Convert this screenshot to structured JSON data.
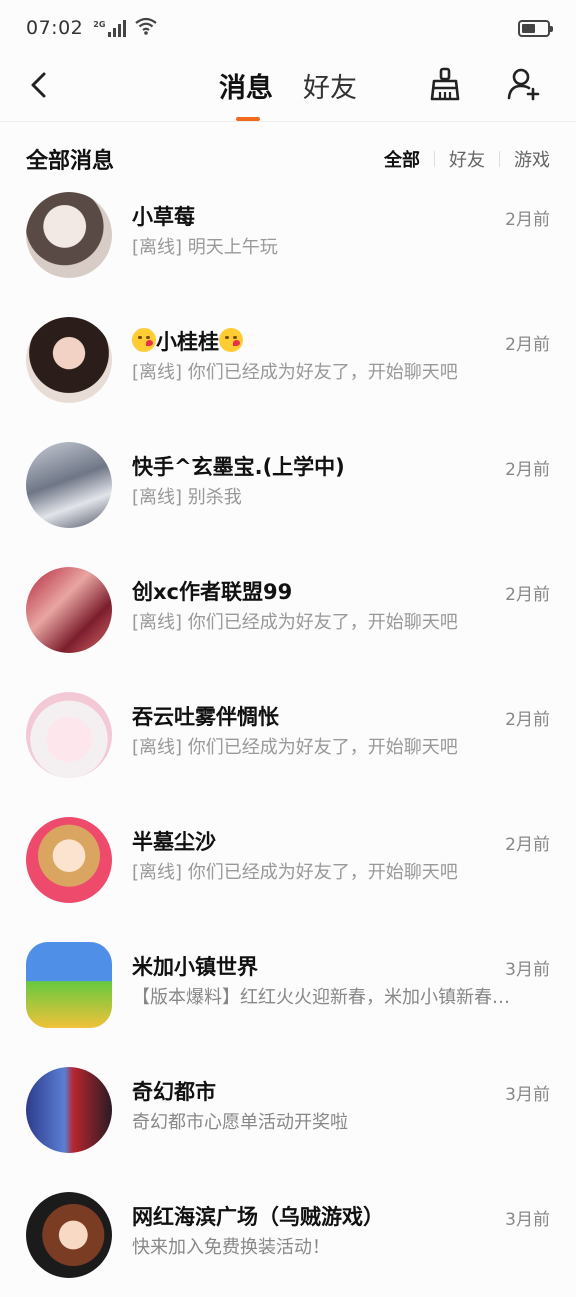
{
  "status_bar": {
    "time": "07:02",
    "network_type": "2G",
    "battery_level": 0.55
  },
  "nav": {
    "tabs": [
      {
        "label": "消息",
        "active": true
      },
      {
        "label": "好友",
        "active": false
      }
    ],
    "accent_color": "#f26b1d"
  },
  "list_header": {
    "title": "全部消息",
    "filters": [
      "全部",
      "好友",
      "游戏"
    ],
    "active_filter": "全部"
  },
  "conversations": [
    {
      "name": "小草莓",
      "preview": "[离线] 明天上午玩",
      "time": "2月前"
    },
    {
      "name": "小桂桂",
      "preview": "[离线] 你们已经成为好友了，开始聊天吧",
      "time": "2月前"
    },
    {
      "name": "快手^玄墨宝.(上学中)",
      "preview": "[离线] 别杀我",
      "time": "2月前"
    },
    {
      "name": "创xc作者联盟99",
      "preview": "[离线] 你们已经成为好友了，开始聊天吧",
      "time": "2月前"
    },
    {
      "name": "吞云吐雾伴惆怅",
      "preview": "[离线] 你们已经成为好友了，开始聊天吧",
      "time": "2月前"
    },
    {
      "name": "半墓尘沙",
      "preview": "[离线] 你们已经成为好友了，开始聊天吧",
      "time": "2月前"
    },
    {
      "name": "米加小镇世界",
      "preview": "【版本爆料】红红火火迎新春，米加小镇新春…",
      "time": "3月前"
    },
    {
      "name": "奇幻都市",
      "preview": "奇幻都市心愿单活动开奖啦",
      "time": "3月前"
    },
    {
      "name": "网红海滨广场（乌贼游戏）",
      "preview": "快来加入免费换装活动！",
      "time": "3月前"
    }
  ]
}
